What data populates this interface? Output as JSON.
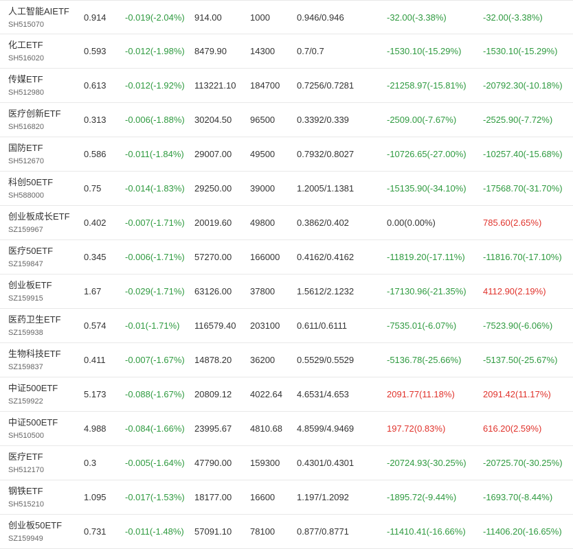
{
  "colors": {
    "up": "#e0322b",
    "down": "#2e9a3f",
    "flat": "#333333"
  },
  "rows": [
    {
      "name": "人工智能AIETF",
      "code": "SH515070",
      "price": "0.914",
      "change": "-0.019(-2.04%)",
      "value": "914.00",
      "quantity": "1000",
      "cost": "0.946/0.946",
      "pl1": "-32.00(-3.38%)",
      "pl1_dir": "down",
      "pl2": "-32.00(-3.38%)",
      "pl2_dir": "down"
    },
    {
      "name": "化工ETF",
      "code": "SH516020",
      "price": "0.593",
      "change": "-0.012(-1.98%)",
      "value": "8479.90",
      "quantity": "14300",
      "cost": "0.7/0.7",
      "pl1": "-1530.10(-15.29%)",
      "pl1_dir": "down",
      "pl2": "-1530.10(-15.29%)",
      "pl2_dir": "down"
    },
    {
      "name": "传媒ETF",
      "code": "SH512980",
      "price": "0.613",
      "change": "-0.012(-1.92%)",
      "value": "113221.10",
      "quantity": "184700",
      "cost": "0.7256/0.7281",
      "pl1": "-21258.97(-15.81%)",
      "pl1_dir": "down",
      "pl2": "-20792.30(-10.18%)",
      "pl2_dir": "down"
    },
    {
      "name": "医疗创新ETF",
      "code": "SH516820",
      "price": "0.313",
      "change": "-0.006(-1.88%)",
      "value": "30204.50",
      "quantity": "96500",
      "cost": "0.3392/0.339",
      "pl1": "-2509.00(-7.67%)",
      "pl1_dir": "down",
      "pl2": "-2525.90(-7.72%)",
      "pl2_dir": "down"
    },
    {
      "name": "国防ETF",
      "code": "SH512670",
      "price": "0.586",
      "change": "-0.011(-1.84%)",
      "value": "29007.00",
      "quantity": "49500",
      "cost": "0.7932/0.8027",
      "pl1": "-10726.65(-27.00%)",
      "pl1_dir": "down",
      "pl2": "-10257.40(-15.68%)",
      "pl2_dir": "down"
    },
    {
      "name": "科创50ETF",
      "code": "SH588000",
      "price": "0.75",
      "change": "-0.014(-1.83%)",
      "value": "29250.00",
      "quantity": "39000",
      "cost": "1.2005/1.1381",
      "pl1": "-15135.90(-34.10%)",
      "pl1_dir": "down",
      "pl2": "-17568.70(-31.70%)",
      "pl2_dir": "down"
    },
    {
      "name": "创业板成长ETF",
      "code": "SZ159967",
      "price": "0.402",
      "change": "-0.007(-1.71%)",
      "value": "20019.60",
      "quantity": "49800",
      "cost": "0.3862/0.402",
      "pl1": "0.00(0.00%)",
      "pl1_dir": "flat",
      "pl2": "785.60(2.65%)",
      "pl2_dir": "up"
    },
    {
      "name": "医疗50ETF",
      "code": "SZ159847",
      "price": "0.345",
      "change": "-0.006(-1.71%)",
      "value": "57270.00",
      "quantity": "166000",
      "cost": "0.4162/0.4162",
      "pl1": "-11819.20(-17.11%)",
      "pl1_dir": "down",
      "pl2": "-11816.70(-17.10%)",
      "pl2_dir": "down"
    },
    {
      "name": "创业板ETF",
      "code": "SZ159915",
      "price": "1.67",
      "change": "-0.029(-1.71%)",
      "value": "63126.00",
      "quantity": "37800",
      "cost": "1.5612/2.1232",
      "pl1": "-17130.96(-21.35%)",
      "pl1_dir": "down",
      "pl2": "4112.90(2.19%)",
      "pl2_dir": "up"
    },
    {
      "name": "医药卫生ETF",
      "code": "SZ159938",
      "price": "0.574",
      "change": "-0.01(-1.71%)",
      "value": "116579.40",
      "quantity": "203100",
      "cost": "0.611/0.6111",
      "pl1": "-7535.01(-6.07%)",
      "pl1_dir": "down",
      "pl2": "-7523.90(-6.06%)",
      "pl2_dir": "down"
    },
    {
      "name": "生物科技ETF",
      "code": "SZ159837",
      "price": "0.411",
      "change": "-0.007(-1.67%)",
      "value": "14878.20",
      "quantity": "36200",
      "cost": "0.5529/0.5529",
      "pl1": "-5136.78(-25.66%)",
      "pl1_dir": "down",
      "pl2": "-5137.50(-25.67%)",
      "pl2_dir": "down"
    },
    {
      "name": "中证500ETF",
      "code": "SZ159922",
      "price": "5.173",
      "change": "-0.088(-1.67%)",
      "value": "20809.12",
      "quantity": "4022.64",
      "cost": "4.6531/4.653",
      "pl1": "2091.77(11.18%)",
      "pl1_dir": "up",
      "pl2": "2091.42(11.17%)",
      "pl2_dir": "up"
    },
    {
      "name": "中证500ETF",
      "code": "SH510500",
      "price": "4.988",
      "change": "-0.084(-1.66%)",
      "value": "23995.67",
      "quantity": "4810.68",
      "cost": "4.8599/4.9469",
      "pl1": "197.72(0.83%)",
      "pl1_dir": "up",
      "pl2": "616.20(2.59%)",
      "pl2_dir": "up"
    },
    {
      "name": "医疗ETF",
      "code": "SH512170",
      "price": "0.3",
      "change": "-0.005(-1.64%)",
      "value": "47790.00",
      "quantity": "159300",
      "cost": "0.4301/0.4301",
      "pl1": "-20724.93(-30.25%)",
      "pl1_dir": "down",
      "pl2": "-20725.70(-30.25%)",
      "pl2_dir": "down"
    },
    {
      "name": "钢铁ETF",
      "code": "SH515210",
      "price": "1.095",
      "change": "-0.017(-1.53%)",
      "value": "18177.00",
      "quantity": "16600",
      "cost": "1.197/1.2092",
      "pl1": "-1895.72(-9.44%)",
      "pl1_dir": "down",
      "pl2": "-1693.70(-8.44%)",
      "pl2_dir": "down"
    },
    {
      "name": "创业板50ETF",
      "code": "SZ159949",
      "price": "0.731",
      "change": "-0.011(-1.48%)",
      "value": "57091.10",
      "quantity": "78100",
      "cost": "0.877/0.8771",
      "pl1": "-11410.41(-16.66%)",
      "pl1_dir": "down",
      "pl2": "-11406.20(-16.65%)",
      "pl2_dir": "down"
    }
  ]
}
